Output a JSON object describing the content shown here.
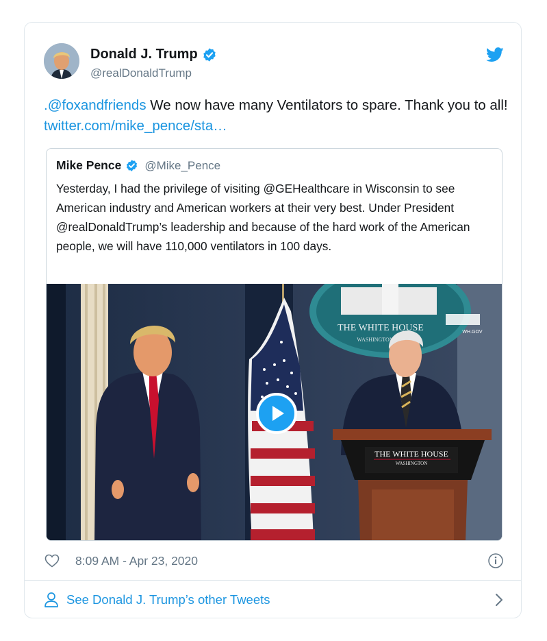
{
  "tweet": {
    "author_name": "Donald J. Trump",
    "author_handle": "@realDonaldTrump",
    "mention": ".@foxandfriends",
    "text": " We now have many Ventilators to spare. Thank you to all! ",
    "link": "twitter.com/mike_pence/sta…",
    "timestamp": "8:09 AM - Apr 23, 2020"
  },
  "quoted": {
    "author_name": "Mike Pence",
    "author_handle": "@Mike_Pence",
    "text": "Yesterday, I had the privilege of visiting @GEHealthcare in Wisconsin to see American industry and American workers at their very best. Under President @realDonaldTrump’s leadership and because of the hard work of the American people, we will have 110,000 ventilators in 100 days.",
    "media": {
      "seal_text": "THE WHITE HOUSE",
      "seal_sub": "WASHINGTON",
      "seal_url": "WH.GOV",
      "podium_text": "THE WHITE HOUSE",
      "podium_sub": "WASHINGTON"
    }
  },
  "footer": {
    "label": "See Donald J. Trump’s other Tweets"
  },
  "icons": [
    "verified-icon",
    "twitter-bird-icon",
    "play-icon",
    "heart-icon",
    "info-icon",
    "person-icon",
    "chevron-right-icon"
  ],
  "colors": {
    "link": "#1b95e0",
    "verified": "#1da1f2",
    "muted": "#657786",
    "border": "#e1e8ed"
  }
}
